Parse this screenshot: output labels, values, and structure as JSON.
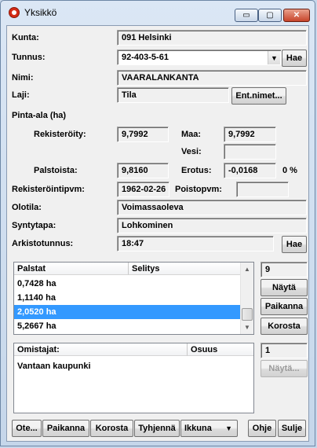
{
  "window": {
    "title": "Yksikkö",
    "minimize_glyph": "▭",
    "maximize_glyph": "▢",
    "close_glyph": "✕",
    "icon": "app-target-icon",
    "accent": "#3399ff"
  },
  "form": {
    "kunta_label": "Kunta:",
    "kunta_value": "091 Helsinki",
    "tunnus_label": "Tunnus:",
    "tunnus_value": "92-403-5-61",
    "tunnus_arrow": "▼",
    "tunnus_hae": "Hae",
    "nimi_label": "Nimi:",
    "nimi_value": "VAARALANKANTA",
    "laji_label": "Laji:",
    "laji_value": "Tila",
    "entnimet_button": "Ent.nimet...",
    "pintaala_label": "Pinta-ala (ha)",
    "rekisteroity_label": "Rekisteröity:",
    "rekisteroity_value": "9,7992",
    "maa_label": "Maa:",
    "maa_value": "9,7992",
    "vesi_label": "Vesi:",
    "vesi_value": "",
    "palstoista_label": "Palstoista:",
    "palstoista_value": "9,8160",
    "erotus_label": "Erotus:",
    "erotus_value": "-0,0168",
    "erotus_pct": "0 %",
    "rekpvm_label": "Rekisteröintipvm:",
    "rekpvm_value": "1962-02-26",
    "poistopvm_label": "Poistopvm:",
    "poistopvm_value": "",
    "olotila_label": "Olotila:",
    "olotila_value": "Voimassaoleva",
    "syntytapa_label": "Syntytapa:",
    "syntytapa_value": "Lohkominen",
    "arkisto_label": "Arkistotunnus:",
    "arkisto_value": "18:47",
    "arkisto_hae": "Hae"
  },
  "palstat": {
    "headers": [
      "Palstat",
      "Selitys"
    ],
    "rows": [
      "0,7428 ha",
      "1,1140 ha",
      "2,0520 ha",
      "5,2667 ha"
    ],
    "selected_row": "2,0520 ha",
    "count": "9",
    "nayta_button": "Näytä",
    "paikanna_button": "Paikanna",
    "korosta_button": "Korosta"
  },
  "omistajat": {
    "headers": [
      "Omistajat:",
      "Osuus"
    ],
    "rows": [
      "Vantaan kaupunki"
    ],
    "count": "1",
    "nayta_button": "Näytä..."
  },
  "toolbar": {
    "ote": "Ote...",
    "paikanna": "Paikanna",
    "korosta": "Korosta",
    "tyhjenna": "Tyhjennä",
    "ikkuna": "Ikkuna",
    "ikkuna_arrow": "▼",
    "ohje": "Ohje",
    "sulje": "Sulje"
  }
}
